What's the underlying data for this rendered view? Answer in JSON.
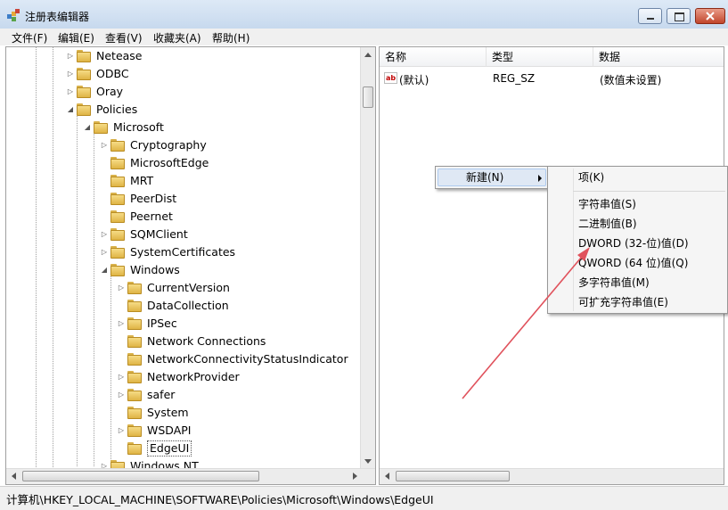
{
  "window": {
    "title": "注册表编辑器"
  },
  "menubar": [
    {
      "name": "menu-file",
      "label": "文件(F)"
    },
    {
      "name": "menu-edit",
      "label": "编辑(E)"
    },
    {
      "name": "menu-view",
      "label": "查看(V)"
    },
    {
      "name": "menu-favorites",
      "label": "收藏夹(A)"
    },
    {
      "name": "menu-help",
      "label": "帮助(H)"
    }
  ],
  "tree": [
    {
      "label": "Netease",
      "level": 0,
      "expander": "collapsed"
    },
    {
      "label": "ODBC",
      "level": 0,
      "expander": "collapsed"
    },
    {
      "label": "Oray",
      "level": 0,
      "expander": "collapsed"
    },
    {
      "label": "Policies",
      "level": 0,
      "expander": "expanded"
    },
    {
      "label": "Microsoft",
      "level": 1,
      "expander": "expanded"
    },
    {
      "label": "Cryptography",
      "level": 2,
      "expander": "collapsed"
    },
    {
      "label": "MicrosoftEdge",
      "level": 2,
      "expander": "none"
    },
    {
      "label": "MRT",
      "level": 2,
      "expander": "none"
    },
    {
      "label": "PeerDist",
      "level": 2,
      "expander": "none"
    },
    {
      "label": "Peernet",
      "level": 2,
      "expander": "none"
    },
    {
      "label": "SQMClient",
      "level": 2,
      "expander": "collapsed"
    },
    {
      "label": "SystemCertificates",
      "level": 2,
      "expander": "collapsed"
    },
    {
      "label": "Windows",
      "level": 2,
      "expander": "expanded"
    },
    {
      "label": "CurrentVersion",
      "level": 3,
      "expander": "collapsed"
    },
    {
      "label": "DataCollection",
      "level": 3,
      "expander": "none"
    },
    {
      "label": "IPSec",
      "level": 3,
      "expander": "collapsed"
    },
    {
      "label": "Network Connections",
      "level": 3,
      "expander": "none"
    },
    {
      "label": "NetworkConnectivityStatusIndicator",
      "level": 3,
      "expander": "none"
    },
    {
      "label": "NetworkProvider",
      "level": 3,
      "expander": "collapsed"
    },
    {
      "label": "safer",
      "level": 3,
      "expander": "collapsed"
    },
    {
      "label": "System",
      "level": 3,
      "expander": "none"
    },
    {
      "label": "WSDAPI",
      "level": 3,
      "expander": "collapsed"
    },
    {
      "label": "EdgeUI",
      "level": 3,
      "expander": "none",
      "selected": true
    },
    {
      "label": "Windows NT",
      "level": 2,
      "expander": "collapsed"
    }
  ],
  "values_pane": {
    "columns": {
      "name": "名称",
      "type": "类型",
      "data": "数据"
    },
    "rows": [
      {
        "name": "(默认)",
        "type": "REG_SZ",
        "data": "(数值未设置)",
        "icon": "string-value-icon"
      }
    ]
  },
  "context_menu": {
    "new_label": "新建(N)",
    "submenu": [
      {
        "name": "ctx-new-key",
        "label": "项(K)"
      },
      {
        "name": "ctx-new-string",
        "label": "字符串值(S)"
      },
      {
        "name": "ctx-new-binary",
        "label": "二进制值(B)"
      },
      {
        "name": "ctx-new-dword",
        "label": "DWORD (32-位)值(D)"
      },
      {
        "name": "ctx-new-qword",
        "label": "QWORD (64 位)值(Q)"
      },
      {
        "name": "ctx-new-multistring",
        "label": "多字符串值(M)"
      },
      {
        "name": "ctx-new-expandstring",
        "label": "可扩充字符串值(E)"
      }
    ]
  },
  "statusbar": {
    "path": "计算机\\HKEY_LOCAL_MACHINE\\SOFTWARE\\Policies\\Microsoft\\Windows\\EdgeUI"
  },
  "colors": {
    "annotation_arrow": "#e0525c",
    "selection": "#dfe8f4"
  }
}
